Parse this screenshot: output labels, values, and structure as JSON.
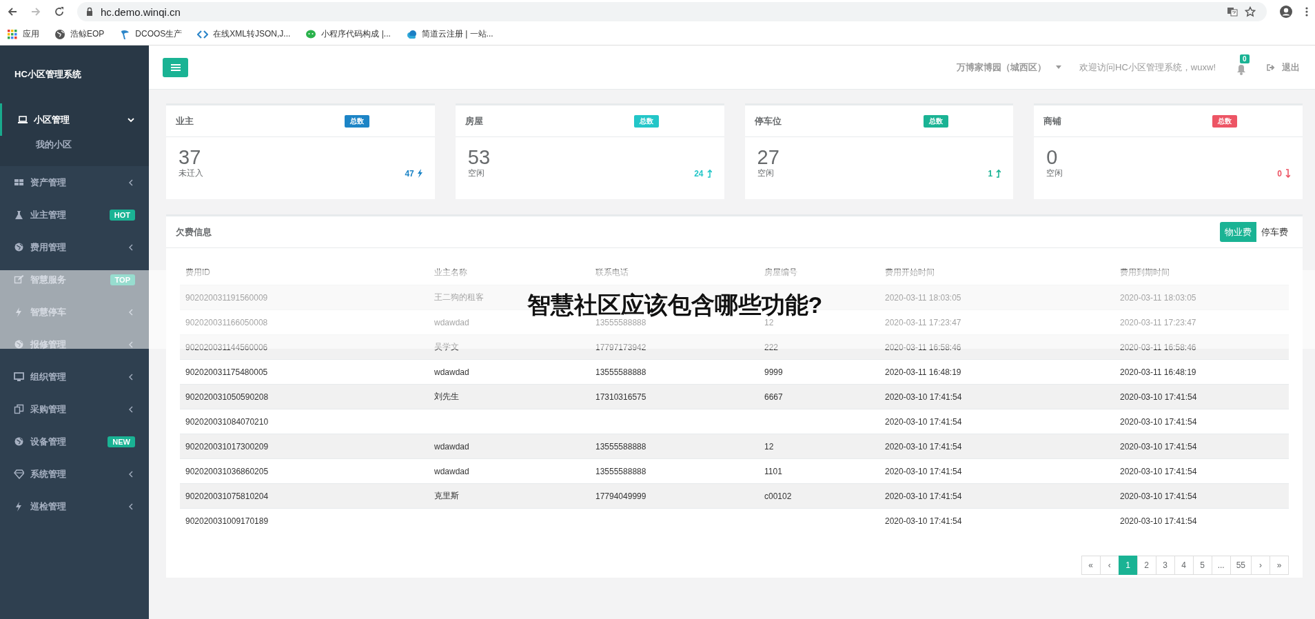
{
  "browser": {
    "url": "hc.demo.winqi.cn",
    "bookmarks": [
      {
        "label": "应用"
      },
      {
        "label": "浩鲸EOP"
      },
      {
        "label": "DCOOS生产"
      },
      {
        "label": "在线XML转JSON,J..."
      },
      {
        "label": "小程序代码构成 |..."
      },
      {
        "label": "简道云注册 | 一站..."
      }
    ]
  },
  "sidebar": {
    "title": "HC小区管理系统",
    "menu": [
      {
        "label": "小区管理",
        "expanded": true,
        "children": [
          {
            "label": "我的小区"
          }
        ]
      },
      {
        "label": "资产管理",
        "expanded": false
      },
      {
        "label": "业主管理",
        "badge": "HOT"
      },
      {
        "label": "费用管理",
        "expanded": false
      },
      {
        "label": "智慧服务",
        "badge": "TOP"
      },
      {
        "label": "智慧停车",
        "expanded": false
      },
      {
        "label": "报修管理",
        "expanded": false
      },
      {
        "label": "组织管理",
        "expanded": false
      },
      {
        "label": "采购管理",
        "expanded": false
      },
      {
        "label": "设备管理",
        "badge": "NEW"
      },
      {
        "label": "系统管理",
        "expanded": false
      },
      {
        "label": "巡检管理",
        "expanded": false
      }
    ]
  },
  "header": {
    "community": "万博家博园（城西区）",
    "welcome": "欢迎访问HC小区管理系统，wuxw!",
    "notification_count": "0",
    "logout": "退出"
  },
  "stats": [
    {
      "title": "业主",
      "tag": "总数",
      "color": "#1c84c6",
      "value": "37",
      "label": "未迁入",
      "trend_value": "47",
      "kind": "bolt"
    },
    {
      "title": "房屋",
      "tag": "总数",
      "color": "#23c6c8",
      "value": "53",
      "label": "空闲",
      "trend_value": "24",
      "kind": "up"
    },
    {
      "title": "停车位",
      "tag": "总数",
      "color": "#1ab394",
      "value": "27",
      "label": "空闲",
      "trend_value": "1",
      "kind": "up"
    },
    {
      "title": "商铺",
      "tag": "总数",
      "color": "#ed5565",
      "value": "0",
      "label": "空闲",
      "trend_value": "0",
      "kind": "down"
    }
  ],
  "arrears": {
    "title": "欠费信息",
    "tabs": [
      {
        "label": "物业费",
        "selected": true
      },
      {
        "label": "停车费",
        "selected": false
      }
    ],
    "columns": [
      "费用ID",
      "业主名称",
      "联系电话",
      "房屋编号",
      "费用开始时间",
      "费用到期时间"
    ],
    "rows": [
      [
        "902020031191560009",
        "王二狗的租客",
        "",
        "",
        "2020-03-11 18:03:05",
        "2020-03-11 18:03:05"
      ],
      [
        "902020031166050008",
        "wdawdad",
        "13555588888",
        "12",
        "2020-03-11 17:23:47",
        "2020-03-11 17:23:47"
      ],
      [
        "902020031144560006",
        "吴学文",
        "17797173942",
        "222",
        "2020-03-11 16:58:46",
        "2020-03-11 16:58:46"
      ],
      [
        "902020031175480005",
        "wdawdad",
        "13555588888",
        "9999",
        "2020-03-11 16:48:19",
        "2020-03-11 16:48:19"
      ],
      [
        "902020031050590208",
        "刘先生",
        "17310316575",
        "6667",
        "2020-03-10 17:41:54",
        "2020-03-10 17:41:54"
      ],
      [
        "902020031084070210",
        "",
        "",
        "",
        "2020-03-10 17:41:54",
        "2020-03-10 17:41:54"
      ],
      [
        "902020031017300209",
        "wdawdad",
        "13555588888",
        "12",
        "2020-03-10 17:41:54",
        "2020-03-10 17:41:54"
      ],
      [
        "902020031036860205",
        "wdawdad",
        "13555588888",
        "1101",
        "2020-03-10 17:41:54",
        "2020-03-10 17:41:54"
      ],
      [
        "902020031075810204",
        "克里斯",
        "17794049999",
        "c00102",
        "2020-03-10 17:41:54",
        "2020-03-10 17:41:54"
      ],
      [
        "902020031009170189",
        "",
        "",
        "",
        "2020-03-10 17:41:54",
        "2020-03-10 17:41:54"
      ]
    ],
    "pagination": [
      {
        "label": "«",
        "selected": false
      },
      {
        "label": "‹",
        "selected": false
      },
      {
        "label": "1",
        "selected": true
      },
      {
        "label": "2",
        "selected": false
      },
      {
        "label": "3",
        "selected": false
      },
      {
        "label": "4",
        "selected": false
      },
      {
        "label": "5",
        "selected": false
      },
      {
        "label": "...",
        "selected": false
      },
      {
        "label": "55",
        "selected": false
      },
      {
        "label": "›",
        "selected": false
      },
      {
        "label": "»",
        "selected": false
      }
    ]
  },
  "overlay": {
    "headline": "智慧社区应该包含哪些功能?"
  }
}
